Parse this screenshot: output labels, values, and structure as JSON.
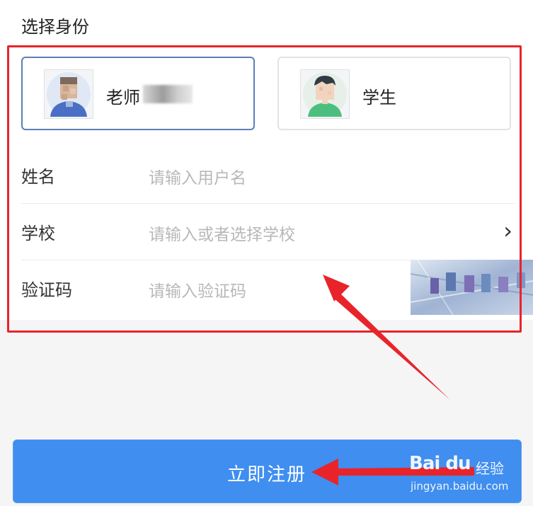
{
  "section_title": "选择身份",
  "identity_options": [
    {
      "label": "老师",
      "selected": true
    },
    {
      "label": "学生",
      "selected": false
    }
  ],
  "form": {
    "name": {
      "label": "姓名",
      "placeholder": "请输入用户名"
    },
    "school": {
      "label": "学校",
      "placeholder": "请输入或者选择学校"
    },
    "code": {
      "label": "验证码",
      "placeholder": "请输入验证码"
    }
  },
  "submit_label": "立即注册",
  "watermark": {
    "brand": "Bai du",
    "name": "经验",
    "url": "jingyan.baidu.com"
  },
  "colors": {
    "accent": "#3f8ef0",
    "highlight_red": "#e8242a",
    "selected_border": "#5b7fb8"
  }
}
